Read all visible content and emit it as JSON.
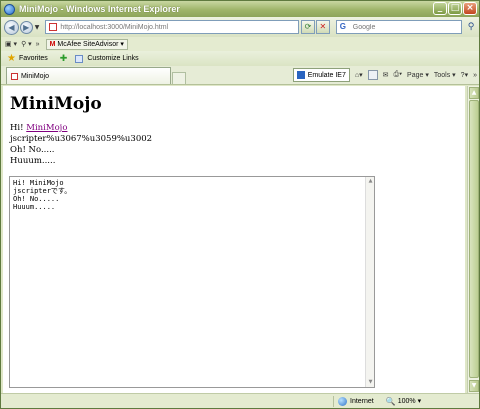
{
  "window": {
    "title": "MiniMojo - Windows Internet Explorer"
  },
  "address_bar": {
    "url": "http://localhost:3000/MiniMojo.html"
  },
  "search": {
    "placeholder": "Google",
    "engine_letter": "G"
  },
  "toolbar": {
    "mcafee_label": "McAfee SiteAdvisor"
  },
  "favorites_bar": {
    "favorites_label": "Favorites",
    "customize_label": "Customize Links"
  },
  "tab": {
    "label": "MiniMojo"
  },
  "command_bar": {
    "emulate_label": "Emulate IE7",
    "page_label": "Page",
    "tools_label": "Tools"
  },
  "page": {
    "heading": "MiniMojo",
    "greeting_prefix": "Hi! ",
    "greeting_link": "MiniMojo",
    "line2": "jscripter%u3067%u3059%u3002",
    "line3": "Oh! No.....",
    "line4": "Huuum....."
  },
  "textarea": {
    "value": "Hi! MiniMojo\njscripterです。\nOh! No.....\nHuuum....."
  },
  "statusbar": {
    "zone": "Internet",
    "zoom": "100%"
  }
}
